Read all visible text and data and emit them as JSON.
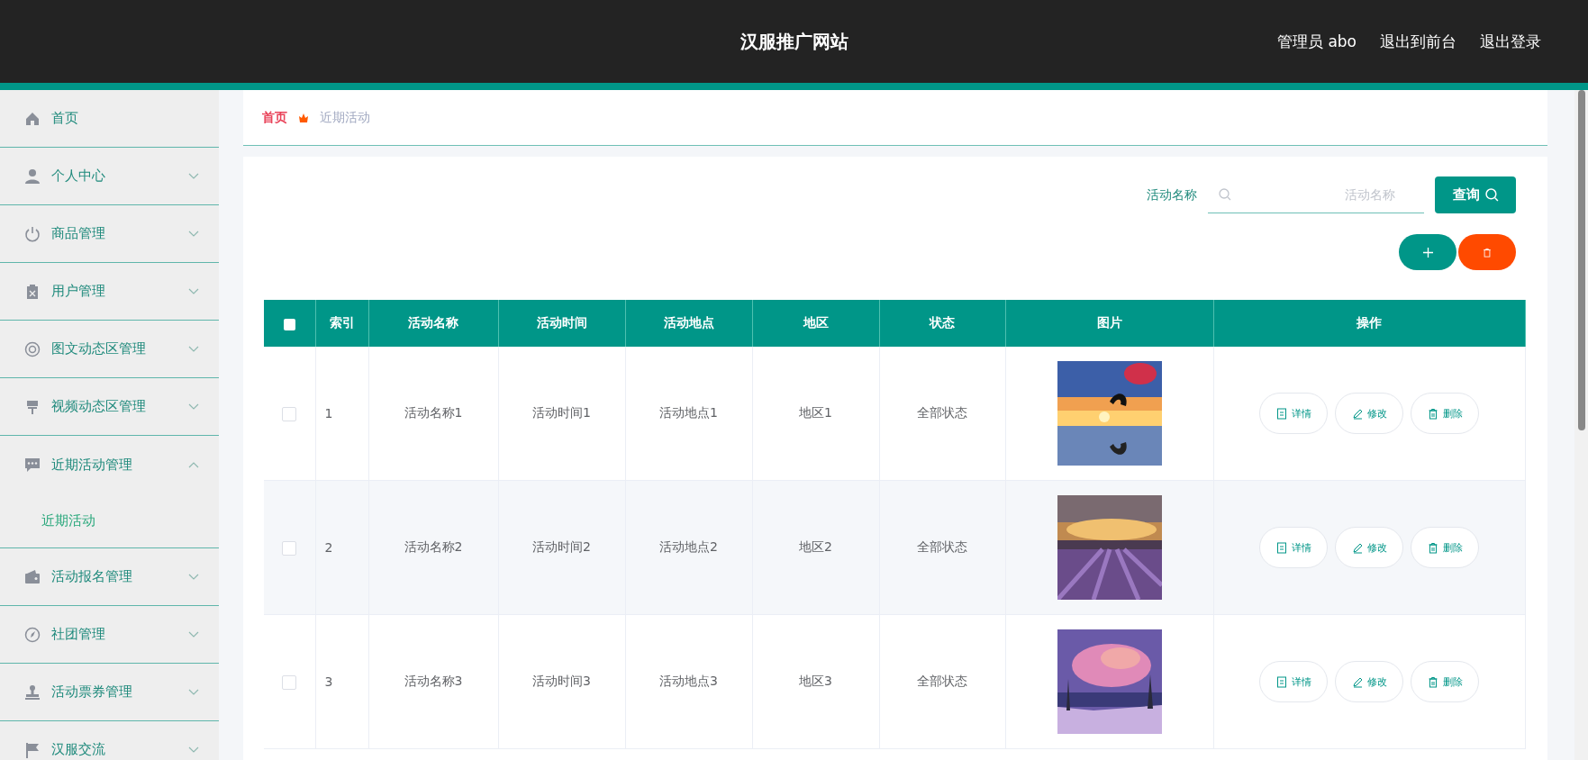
{
  "header": {
    "title": "汉服推广网站",
    "links": [
      "管理员 abo",
      "退出到前台",
      "退出登录"
    ]
  },
  "sidebar": {
    "items": [
      {
        "label": "首页"
      },
      {
        "label": "个人中心",
        "expanded": false
      },
      {
        "label": "商品管理",
        "expanded": false
      },
      {
        "label": "用户管理",
        "expanded": false
      },
      {
        "label": "图文动态区管理",
        "expanded": false
      },
      {
        "label": "视频动态区管理",
        "expanded": false
      },
      {
        "label": "近期活动管理",
        "expanded": true,
        "children": [
          {
            "label": "近期活动",
            "selected": true
          }
        ]
      },
      {
        "label": "活动报名管理",
        "expanded": false
      },
      {
        "label": "社团管理",
        "expanded": false
      },
      {
        "label": "活动票券管理",
        "expanded": false
      },
      {
        "label": "汉服交流",
        "expanded": false
      }
    ]
  },
  "breadcrumb": [
    "首页",
    "近期活动"
  ],
  "search": {
    "label": "活动名称",
    "placeholder": "活动名称",
    "button": "查询"
  },
  "table": {
    "select_all": {
      "checked": false
    },
    "columns": [
      "索引",
      "活动名称",
      "活动时间",
      "活动地点",
      "地区",
      "状态",
      "图片",
      "操作"
    ],
    "rows": [
      {
        "selected": false,
        "cells": [
          "1",
          "活动名称1",
          "活动时间1",
          "活动地点1",
          "地区1",
          "全部状态"
        ],
        "actions": [
          {
            "kind": "detail",
            "label": "详情"
          },
          {
            "kind": "edit",
            "label": "修改"
          },
          {
            "kind": "delete",
            "label": "删除"
          }
        ]
      },
      {
        "selected": false,
        "cells": [
          "2",
          "活动名称2",
          "活动时间2",
          "活动地点2",
          "地区2",
          "全部状态"
        ],
        "actions": [
          {
            "kind": "detail",
            "label": "详情"
          },
          {
            "kind": "edit",
            "label": "修改"
          },
          {
            "kind": "delete",
            "label": "删除"
          }
        ]
      },
      {
        "selected": false,
        "cells": [
          "3",
          "活动名称3",
          "活动时间3",
          "活动地点3",
          "地区3",
          "全部状态"
        ],
        "actions": [
          {
            "kind": "detail",
            "label": "详情"
          },
          {
            "kind": "edit",
            "label": "修改"
          },
          {
            "kind": "delete",
            "label": "删除"
          }
        ]
      }
    ]
  }
}
